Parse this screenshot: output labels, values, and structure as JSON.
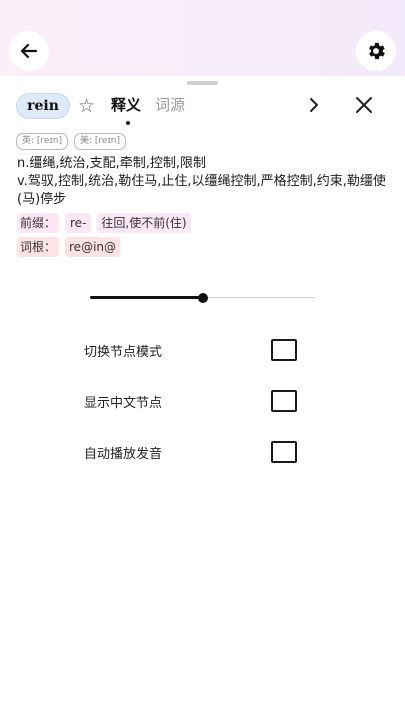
{
  "header": {
    "back_icon": "arrow-left-icon",
    "settings_icon": "gear-icon"
  },
  "word": {
    "text": "rein",
    "favorite_icon": "star-outline-icon"
  },
  "tabs": [
    {
      "label": "释义",
      "active": true
    },
    {
      "label": "词源",
      "active": false
    }
  ],
  "nav": {
    "next_icon": "chevron-right-icon",
    "close_icon": "close-icon"
  },
  "phonetics": [
    {
      "label": "英: [reɪn]"
    },
    {
      "label": "美: [reɪn]"
    }
  ],
  "definition": {
    "noun": "n.缰绳,统治,支配,牵制,控制,限制",
    "verb": "v.驾驭,控制,统治,勒住马,止住,以缰绳控制,严格控制,约束,勒缰使(马)停步"
  },
  "morphology": {
    "prefix_label": "前缀：",
    "prefix_value": "re-",
    "prefix_meaning": "往回,使不前(住)",
    "root_label": "词根：",
    "root_value": "re@in@"
  },
  "slider": {
    "value": 0.5
  },
  "options": [
    {
      "label": "切换节点模式",
      "checked": false
    },
    {
      "label": "显示中文节点",
      "checked": false
    },
    {
      "label": "自动播放发音",
      "checked": false
    }
  ],
  "colors": {
    "header_bg": "#f7eefa",
    "word_chip": "#dfeaf8",
    "prefix_tag": "#fbe7f6",
    "root_tag": "#fde3e3"
  }
}
